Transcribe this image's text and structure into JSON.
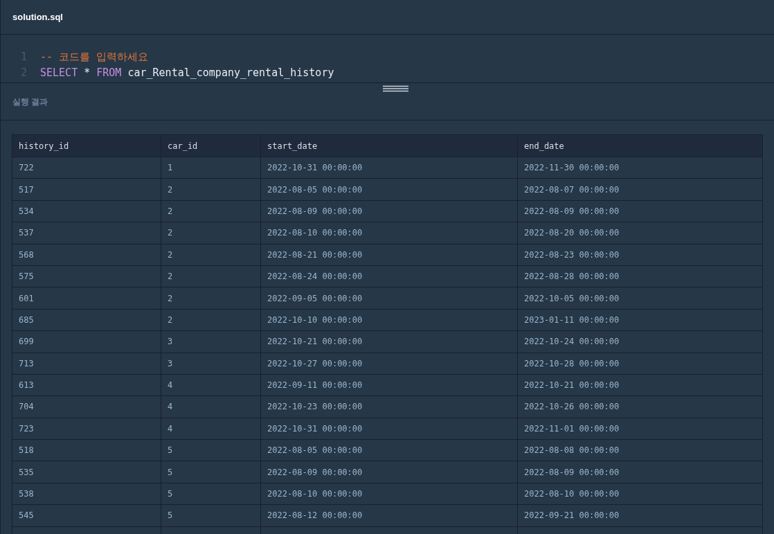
{
  "file_tab": {
    "title": "solution.sql"
  },
  "editor": {
    "lines": [
      {
        "number": "1",
        "tokens": [
          {
            "kind": "comment",
            "text": "-- 코드를 입력하세요"
          }
        ]
      },
      {
        "number": "2",
        "tokens": [
          {
            "kind": "keyword",
            "text": "SELECT"
          },
          {
            "kind": "plain",
            "text": "*"
          },
          {
            "kind": "keyword",
            "text": "FROM"
          },
          {
            "kind": "plain",
            "text": "car_Rental_company_rental_history"
          }
        ]
      }
    ]
  },
  "result": {
    "title": "실행 결과",
    "table": {
      "columns": [
        "history_id",
        "car_id",
        "start_date",
        "end_date"
      ],
      "rows": [
        [
          "722",
          "1",
          "2022-10-31 00:00:00",
          "2022-11-30 00:00:00"
        ],
        [
          "517",
          "2",
          "2022-08-05 00:00:00",
          "2022-08-07 00:00:00"
        ],
        [
          "534",
          "2",
          "2022-08-09 00:00:00",
          "2022-08-09 00:00:00"
        ],
        [
          "537",
          "2",
          "2022-08-10 00:00:00",
          "2022-08-20 00:00:00"
        ],
        [
          "568",
          "2",
          "2022-08-21 00:00:00",
          "2022-08-23 00:00:00"
        ],
        [
          "575",
          "2",
          "2022-08-24 00:00:00",
          "2022-08-28 00:00:00"
        ],
        [
          "601",
          "2",
          "2022-09-05 00:00:00",
          "2022-10-05 00:00:00"
        ],
        [
          "685",
          "2",
          "2022-10-10 00:00:00",
          "2023-01-11 00:00:00"
        ],
        [
          "699",
          "3",
          "2022-10-21 00:00:00",
          "2022-10-24 00:00:00"
        ],
        [
          "713",
          "3",
          "2022-10-27 00:00:00",
          "2022-10-28 00:00:00"
        ],
        [
          "613",
          "4",
          "2022-09-11 00:00:00",
          "2022-10-21 00:00:00"
        ],
        [
          "704",
          "4",
          "2022-10-23 00:00:00",
          "2022-10-26 00:00:00"
        ],
        [
          "723",
          "4",
          "2022-10-31 00:00:00",
          "2022-11-01 00:00:00"
        ],
        [
          "518",
          "5",
          "2022-08-05 00:00:00",
          "2022-08-08 00:00:00"
        ],
        [
          "535",
          "5",
          "2022-08-09 00:00:00",
          "2022-08-09 00:00:00"
        ],
        [
          "538",
          "5",
          "2022-08-10 00:00:00",
          "2022-08-10 00:00:00"
        ],
        [
          "545",
          "5",
          "2022-08-12 00:00:00",
          "2022-09-21 00:00:00"
        ]
      ]
    }
  }
}
